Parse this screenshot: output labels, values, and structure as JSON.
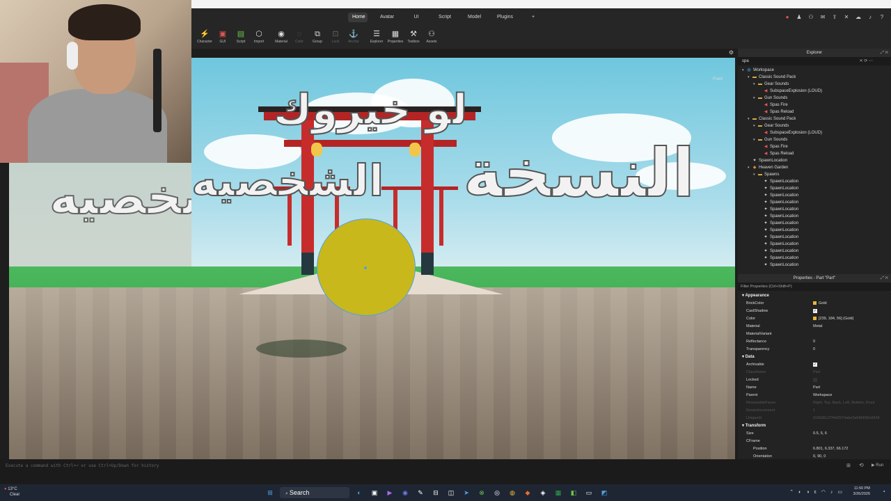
{
  "ribbon": {
    "tabs": [
      "Home",
      "Avatar",
      "UI",
      "Script",
      "Model",
      "Plugins"
    ],
    "active_tab": "Home"
  },
  "toolbar": {
    "tools": [
      {
        "label": "Character",
        "icon": "character-icon",
        "glyph": "⚡",
        "enabled": true
      },
      {
        "label": "GUI",
        "icon": "gui-icon",
        "glyph": "▣",
        "enabled": true
      },
      {
        "label": "Script",
        "icon": "script-icon",
        "glyph": "▤",
        "enabled": true
      },
      {
        "label": "Import",
        "icon": "import-icon",
        "glyph": "⬡",
        "enabled": true
      },
      {
        "label": "Material",
        "icon": "material-icon",
        "glyph": "◉",
        "enabled": true
      },
      {
        "label": "Color",
        "icon": "color-icon",
        "glyph": "◌",
        "enabled": false
      },
      {
        "label": "Group",
        "icon": "group-icon",
        "glyph": "⧉",
        "enabled": true
      },
      {
        "label": "Lock",
        "icon": "lock-icon",
        "glyph": "⊡",
        "enabled": false
      },
      {
        "label": "Anchor",
        "icon": "anchor-icon",
        "glyph": "⚓",
        "enabled": false
      },
      {
        "label": "Explorer",
        "icon": "explorer-icon",
        "glyph": "☰",
        "enabled": true
      },
      {
        "label": "Properties",
        "icon": "properties-icon",
        "glyph": "▦",
        "enabled": true
      },
      {
        "label": "Toolbox",
        "icon": "toolbox-icon",
        "glyph": "⚒",
        "enabled": true
      },
      {
        "label": "Assets",
        "icon": "assets-icon",
        "glyph": "⚇",
        "enabled": true
      }
    ]
  },
  "viewport": {
    "sign_top": "لو خيروك",
    "sign_right": "النسخة",
    "sign_left": "الشخصيه",
    "front_label": "Front"
  },
  "explorer": {
    "title": "Explorer",
    "search_value": "spa",
    "items": [
      {
        "label": "Workspace",
        "depth": 0,
        "icon": "world",
        "arrow": "▾"
      },
      {
        "label": "Classic Sound Pack",
        "depth": 1,
        "icon": "folder",
        "arrow": "▾"
      },
      {
        "label": "Gear Sounds",
        "depth": 2,
        "icon": "folder",
        "arrow": "▾"
      },
      {
        "label": "SubspaceExplosion (LOUD)",
        "depth": 3,
        "icon": "sound",
        "arrow": ""
      },
      {
        "label": "Gun Sounds",
        "depth": 2,
        "icon": "folder",
        "arrow": "▾"
      },
      {
        "label": "Spas Fire",
        "depth": 3,
        "icon": "sound",
        "arrow": ""
      },
      {
        "label": "Spas Reload",
        "depth": 3,
        "icon": "sound",
        "arrow": ""
      },
      {
        "label": "Classic Sound Pack",
        "depth": 1,
        "icon": "folder",
        "arrow": "▾"
      },
      {
        "label": "Gear Sounds",
        "depth": 2,
        "icon": "folder",
        "arrow": "▾"
      },
      {
        "label": "SubspaceExplosion (LOUD)",
        "depth": 3,
        "icon": "sound",
        "arrow": ""
      },
      {
        "label": "Gun Sounds",
        "depth": 2,
        "icon": "folder",
        "arrow": "▾"
      },
      {
        "label": "Spas Fire",
        "depth": 3,
        "icon": "sound",
        "arrow": ""
      },
      {
        "label": "Spas Reload",
        "depth": 3,
        "icon": "sound",
        "arrow": ""
      },
      {
        "label": "SpawnLocation",
        "depth": 1,
        "icon": "spawn",
        "arrow": ""
      },
      {
        "label": "Heaven Garden",
        "depth": 1,
        "icon": "model",
        "arrow": "▾"
      },
      {
        "label": "Spawns",
        "depth": 2,
        "icon": "folder",
        "arrow": "▾"
      },
      {
        "label": "SpawnLocation",
        "depth": 3,
        "icon": "spawn",
        "arrow": ""
      },
      {
        "label": "SpawnLocation",
        "depth": 3,
        "icon": "spawn",
        "arrow": ""
      },
      {
        "label": "SpawnLocation",
        "depth": 3,
        "icon": "spawn",
        "arrow": ""
      },
      {
        "label": "SpawnLocation",
        "depth": 3,
        "icon": "spawn",
        "arrow": ""
      },
      {
        "label": "SpawnLocation",
        "depth": 3,
        "icon": "spawn",
        "arrow": ""
      },
      {
        "label": "SpawnLocation",
        "depth": 3,
        "icon": "spawn",
        "arrow": ""
      },
      {
        "label": "SpawnLocation",
        "depth": 3,
        "icon": "spawn",
        "arrow": ""
      },
      {
        "label": "SpawnLocation",
        "depth": 3,
        "icon": "spawn",
        "arrow": ""
      },
      {
        "label": "SpawnLocation",
        "depth": 3,
        "icon": "spawn",
        "arrow": ""
      },
      {
        "label": "SpawnLocation",
        "depth": 3,
        "icon": "spawn",
        "arrow": ""
      },
      {
        "label": "SpawnLocation",
        "depth": 3,
        "icon": "spawn",
        "arrow": ""
      },
      {
        "label": "SpawnLocation",
        "depth": 3,
        "icon": "spawn",
        "arrow": ""
      },
      {
        "label": "SpawnLocation",
        "depth": 3,
        "icon": "spawn",
        "arrow": ""
      }
    ]
  },
  "properties": {
    "title": "Properties - Part \"Part\"",
    "filter_placeholder": "Filter Properties (Ctrl+Shift+P)",
    "rows": [
      {
        "type": "section",
        "name": "Appearance"
      },
      {
        "type": "prop",
        "name": "BrickColor",
        "value": "Gold",
        "swatch": "#e6b83a"
      },
      {
        "type": "prop",
        "name": "CastShadow",
        "check": true
      },
      {
        "type": "prop",
        "name": "Color",
        "value": "[239, 184, 56] (Gold)",
        "swatch": "#efb838"
      },
      {
        "type": "prop",
        "name": "Material",
        "value": "Metal"
      },
      {
        "type": "prop",
        "name": "MaterialVariant",
        "value": ""
      },
      {
        "type": "prop",
        "name": "Reflectance",
        "value": "0"
      },
      {
        "type": "prop",
        "name": "Transparency",
        "value": "0"
      },
      {
        "type": "section",
        "name": "Data"
      },
      {
        "type": "prop",
        "name": "Archivable",
        "check": true
      },
      {
        "type": "prop",
        "name": "ClassName",
        "value": "Part",
        "dim": true
      },
      {
        "type": "prop",
        "name": "Locked",
        "check": false
      },
      {
        "type": "prop",
        "name": "Name",
        "value": "Part"
      },
      {
        "type": "prop",
        "name": "Parent",
        "value": "Workspace"
      },
      {
        "type": "prop",
        "name": "ResizeableFaces",
        "value": "Right, Top, Back, Left, Bottom, Front",
        "dim": true
      },
      {
        "type": "prop",
        "name": "ResizeIncrement",
        "value": "1",
        "dim": true
      },
      {
        "type": "prop",
        "name": "UniqueId",
        "value": "0180d5c27f4d2974abe3a69b690c6436",
        "dim": true
      },
      {
        "type": "section",
        "name": "Transform"
      },
      {
        "type": "prop",
        "name": "Size",
        "value": "0.5, 5, 6"
      },
      {
        "type": "prop",
        "name": "CFrame",
        "value": ""
      },
      {
        "type": "prop",
        "name": "Position",
        "value": "6.801, 6.337, 66.172",
        "sub": true
      },
      {
        "type": "prop",
        "name": "Orientation",
        "value": "0, 90, 0",
        "sub": true
      }
    ]
  },
  "command_bar": {
    "placeholder": "Execute a command with Ctrl+⏎ or use Ctrl+Up/Down for history",
    "run_label": "Run"
  },
  "taskbar": {
    "weather_temp": "13°C",
    "weather_text": "Clear",
    "search_label": "Search",
    "time": "11:50 PM",
    "date": "3/26/2026"
  }
}
